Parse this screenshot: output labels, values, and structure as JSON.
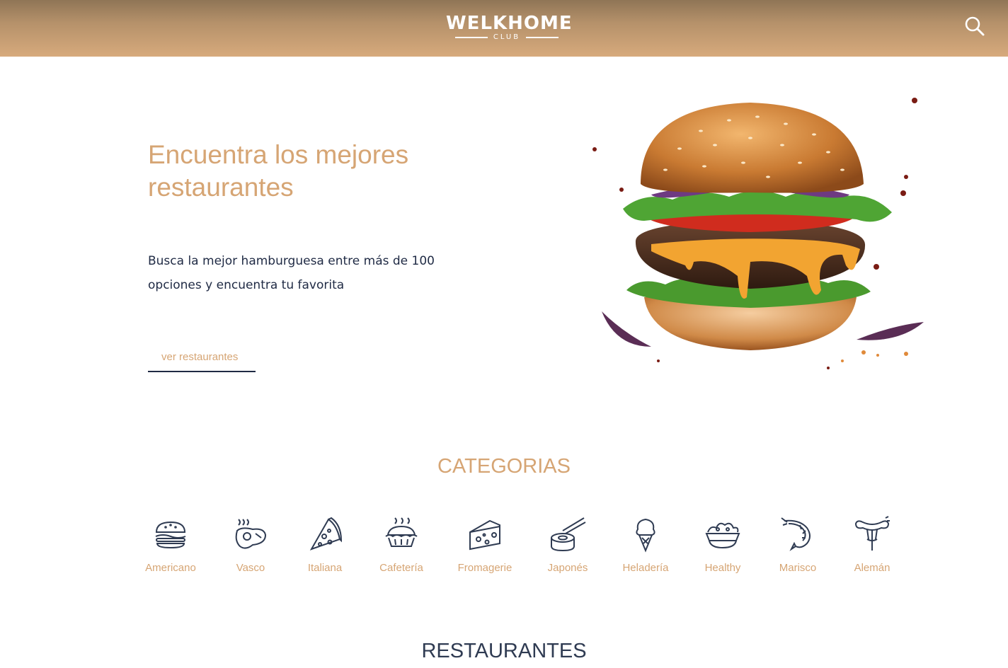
{
  "header": {
    "logo_main": "WELKHOME",
    "logo_sub": "CLUB",
    "search_icon": "search-icon",
    "background_colors": [
      "#8f7556",
      "#d7aa7c"
    ]
  },
  "hero": {
    "title": "Encuentra los mejores restaurantes",
    "description": "Busca la mejor hamburguesa entre más de 100 opciones y encuentra tu favorita",
    "link_label": "ver restaurantes",
    "image": "burger-image"
  },
  "categories": {
    "title": "CATEGORIAS",
    "items": [
      {
        "label": "Americano",
        "icon": "burger-icon"
      },
      {
        "label": "Vasco",
        "icon": "steak-icon"
      },
      {
        "label": "Italiana",
        "icon": "pizza-icon"
      },
      {
        "label": "Cafetería",
        "icon": "pie-icon"
      },
      {
        "label": "Fromagerie",
        "icon": "cheese-icon"
      },
      {
        "label": "Japonés",
        "icon": "sushi-icon"
      },
      {
        "label": "Heladería",
        "icon": "ice-cream-icon"
      },
      {
        "label": "Healthy",
        "icon": "salad-icon"
      },
      {
        "label": "Marisco",
        "icon": "shrimp-icon"
      },
      {
        "label": "Alemán",
        "icon": "sausage-icon"
      }
    ]
  },
  "restaurants": {
    "title": "RESTAURANTES"
  },
  "colors": {
    "accent": "#d6a574",
    "text_dark": "#1f2a44",
    "icon_navy": "#2f3b52"
  }
}
